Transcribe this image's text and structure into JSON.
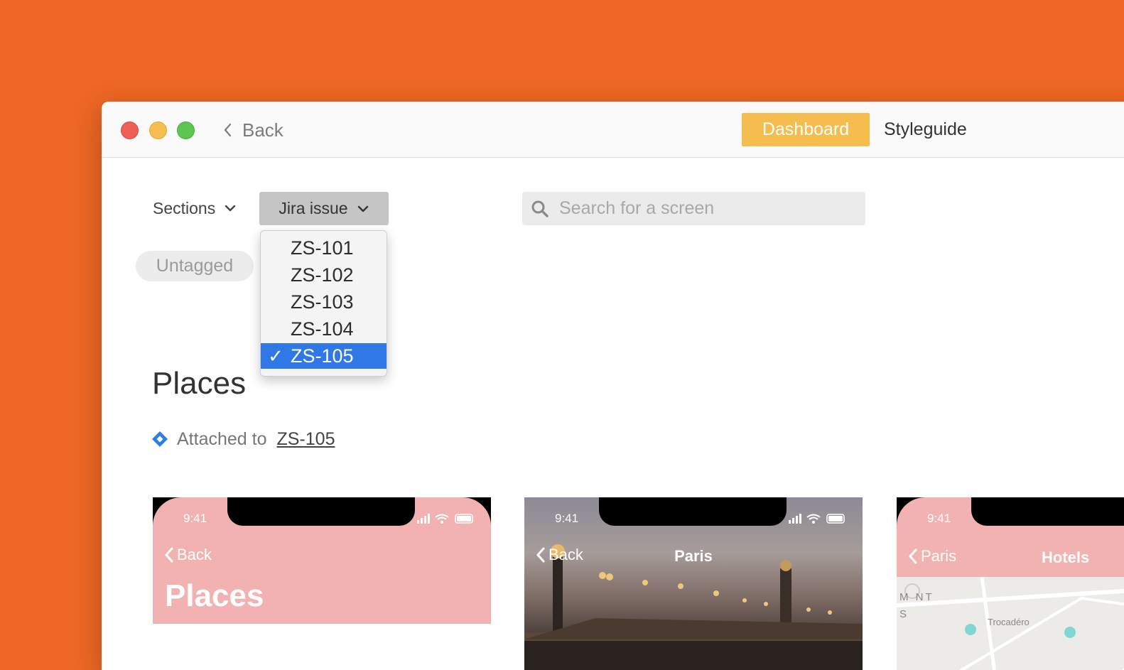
{
  "titlebar": {
    "back_label": "Back",
    "tabs": [
      {
        "label": "Dashboard",
        "active": true
      },
      {
        "label": "Styleguide",
        "active": false
      }
    ]
  },
  "filters": {
    "sections_label": "Sections",
    "jira_label": "Jira issue",
    "search_placeholder": "Search for a screen",
    "tag_pill": "Untagged"
  },
  "dropdown": {
    "items": [
      "ZS-101",
      "ZS-102",
      "ZS-103",
      "ZS-104",
      "ZS-105"
    ],
    "selected": "ZS-105",
    "check_glyph": "✓"
  },
  "section": {
    "title": "Places",
    "attached_prefix": "Attached to",
    "attached_issue": "ZS-105"
  },
  "screens": [
    {
      "time": "9:41",
      "back": "Back",
      "title": "Places"
    },
    {
      "time": "9:41",
      "back": "Back",
      "title": "Paris"
    },
    {
      "time": "9:41",
      "back": "Paris",
      "title": "Hotels",
      "map_labels": [
        "M NT",
        "S",
        "Trocadéro"
      ]
    }
  ],
  "colors": {
    "background": "#ee6724",
    "dashboard_tab": "#f5bd4e",
    "selected_item": "#2f78e6",
    "screen_header": "#f3b2b2",
    "jira_icon": "#2b7de9"
  }
}
